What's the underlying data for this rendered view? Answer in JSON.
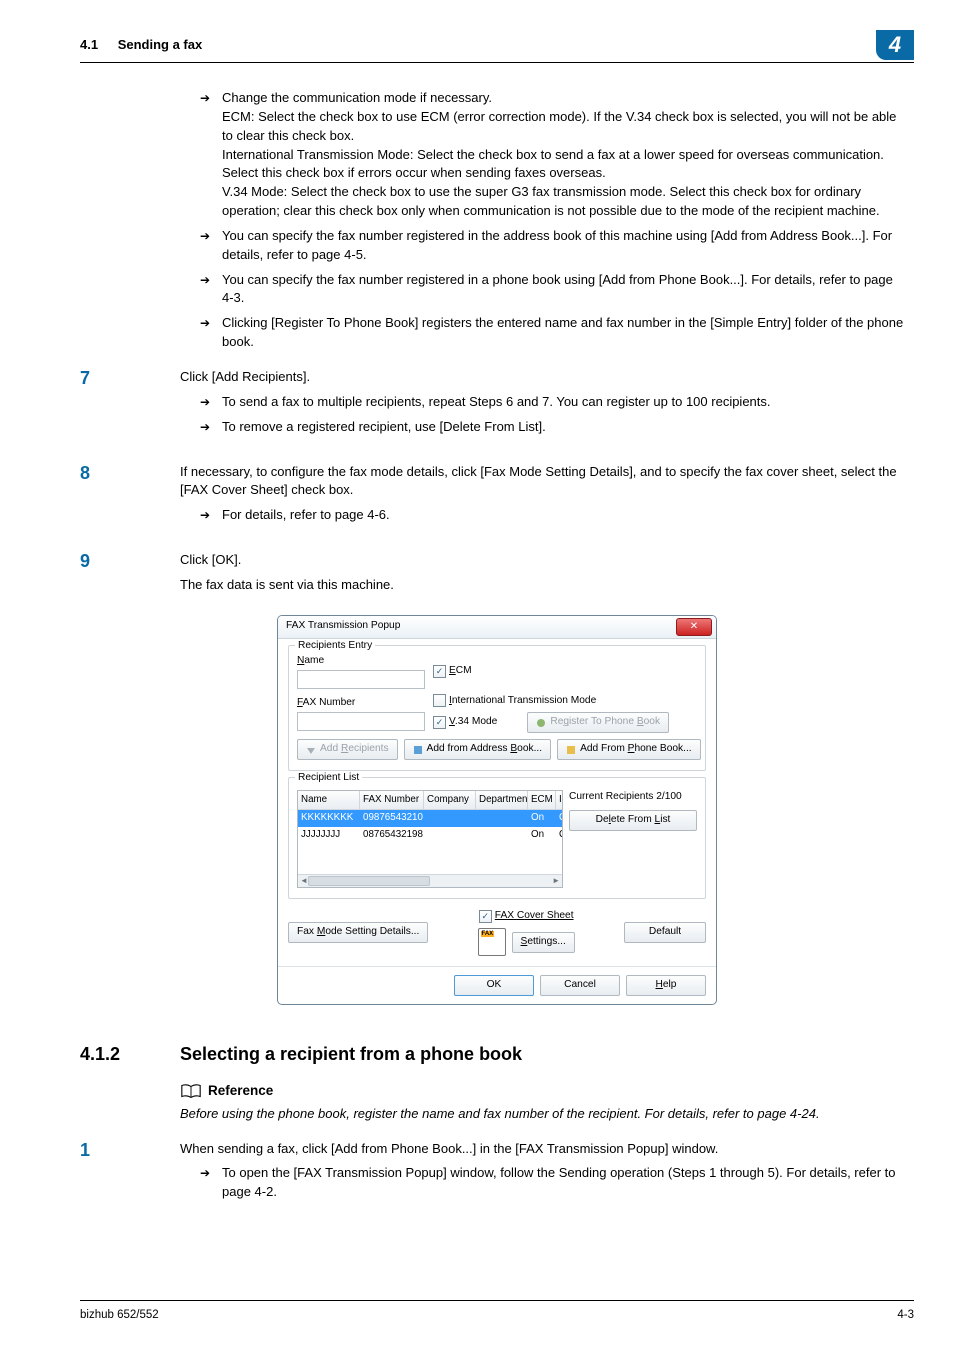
{
  "header": {
    "section_number": "4.1",
    "section_title": "Sending a fax",
    "chapter": "4"
  },
  "body": {
    "intro_bullets": [
      "Change the communication mode if necessary.\nECM: Select the check box to use ECM (error correction mode). If the V.34 check box is selected, you will not be able to clear this check box.\nInternational Transmission Mode: Select the check box to send a fax at a lower speed for overseas communication. Select this check box if errors occur when sending faxes overseas.\nV.34 Mode: Select the check box to use the super G3 fax transmission mode. Select this check box for ordinary operation; clear this check box only when communication is not possible due to the mode of the recipient machine.",
      "You can specify the fax number registered in the address book of this machine using [Add from Address Book...]. For details, refer to page 4-5.",
      "You can specify the fax number registered in a phone book using [Add from Phone Book...]. For details, refer to page 4-3.",
      "Clicking [Register To Phone Book] registers the entered name and fax number in the [Simple Entry] folder of the phone book."
    ],
    "step7": {
      "num": "7",
      "text": "Click [Add Recipients].",
      "bullets": [
        "To send a fax to multiple recipients, repeat Steps 6 and 7. You can register up to 100 recipients.",
        "To remove a registered recipient, use [Delete From List]."
      ]
    },
    "step8": {
      "num": "8",
      "text": "If necessary, to configure the fax mode details, click [Fax Mode Setting Details], and to specify the fax cover sheet, select the [FAX Cover Sheet] check box.",
      "bullets": [
        "For details, refer to page 4-6."
      ]
    },
    "step9": {
      "num": "9",
      "text": "Click [OK].",
      "after": "The fax data is sent via this machine."
    }
  },
  "dialog": {
    "title": "FAX Transmission Popup",
    "group_entry_label": "Recipients Entry",
    "name_label": "Name",
    "fax_number_label": "FAX Number",
    "ecm_label": "ECM",
    "intl_label": "International Transmission Mode",
    "v34_label": "V.34 Mode",
    "register_btn": "Register To Phone Book",
    "add_recipients_btn": "Add Recipients",
    "add_from_addressbook_btn": "Add from Address Book...",
    "add_from_phonebook_btn": "Add From Phone Book...",
    "group_list_label": "Recipient List",
    "cols": {
      "name": "Name",
      "fax": "FAX Number",
      "company": "Company",
      "dept": "Department",
      "ecm": "ECM",
      "intl": "I"
    },
    "rows": [
      {
        "name": "KKKKKKKK",
        "fax": "09876543210",
        "company": "",
        "dept": "",
        "ecm": "On",
        "intl": "Of"
      },
      {
        "name": "JJJJJJJJ",
        "fax": "08765432198",
        "company": "",
        "dept": "",
        "ecm": "On",
        "intl": "Off"
      }
    ],
    "current_recipients": "Current Recipients 2/100",
    "delete_btn": "Delete From List",
    "coversheet_label": "FAX Cover Sheet",
    "settings_btn": "Settings...",
    "fax_mode_btn": "Fax Mode Setting Details...",
    "default_btn": "Default",
    "ok_btn": "OK",
    "cancel_btn": "Cancel",
    "help_btn": "Help"
  },
  "subsection": {
    "num": "4.1.2",
    "title": "Selecting a recipient from a phone book",
    "ref_label": "Reference",
    "ref_text": "Before using the phone book, register the name and fax number of the recipient. For details, refer to page 4-24.",
    "step1": {
      "num": "1",
      "text": "When sending a fax, click [Add from Phone Book...] in the [FAX Transmission Popup] window.",
      "bullets": [
        "To open the [FAX Transmission Popup] window, follow the Sending operation (Steps 1 through 5). For details, refer to page 4-2."
      ]
    }
  },
  "footer": {
    "left": "bizhub 652/552",
    "right": "4-3"
  }
}
